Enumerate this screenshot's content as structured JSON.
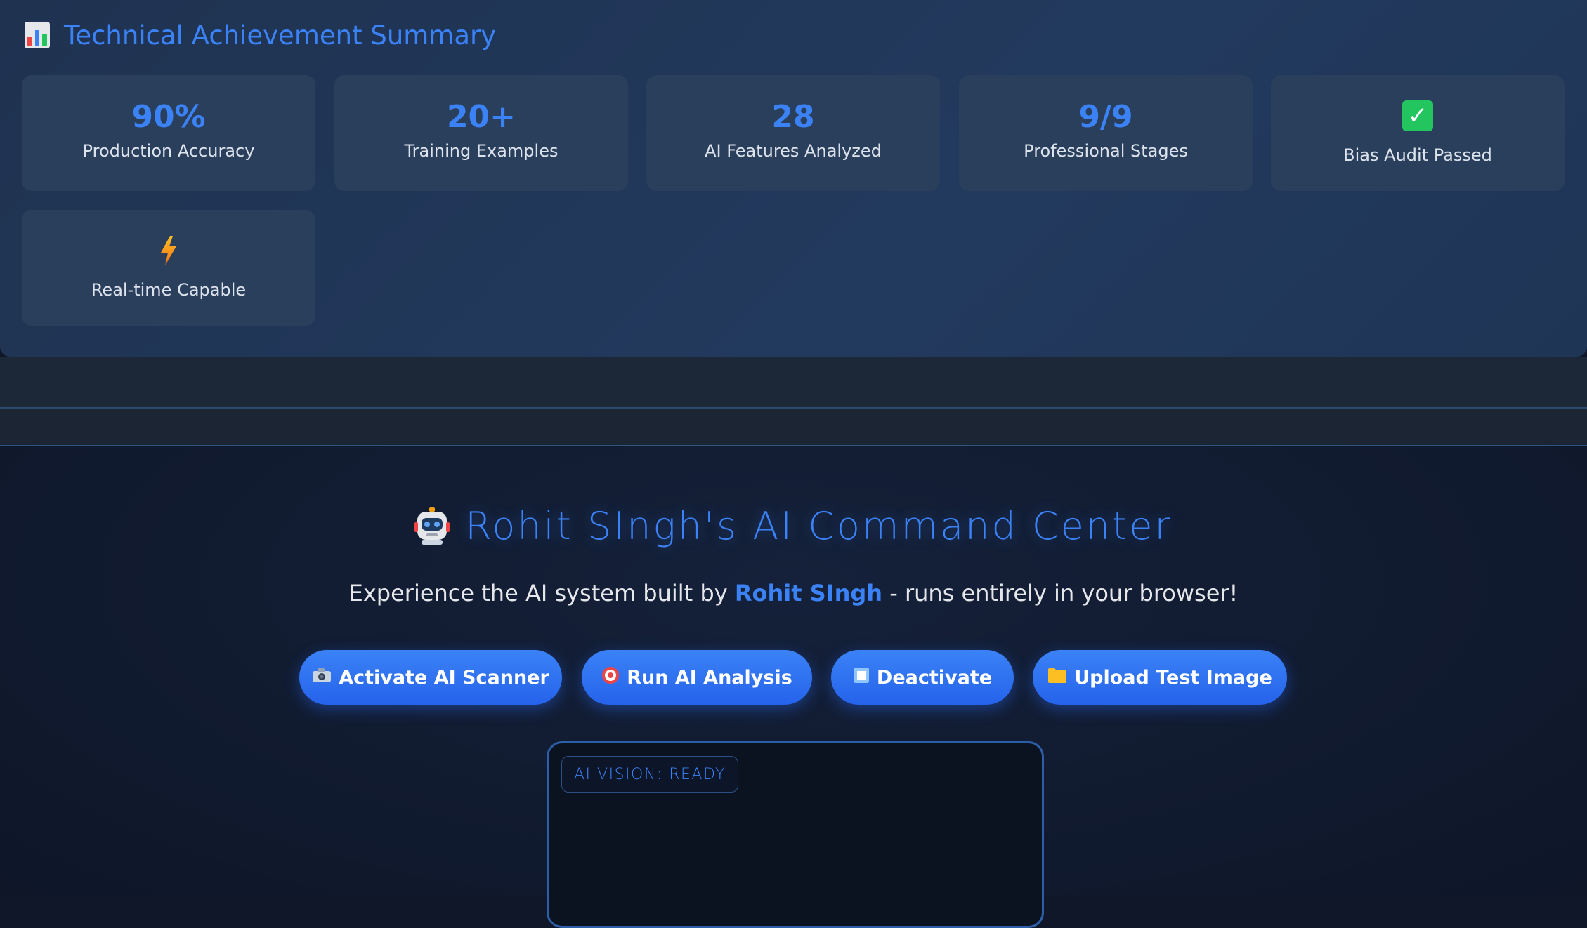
{
  "summary": {
    "title": "Technical Achievement Summary",
    "title_icon": "bar-chart-icon",
    "cards": [
      {
        "value": "90%",
        "label": "Production Accuracy"
      },
      {
        "value": "20+",
        "label": "Training Examples"
      },
      {
        "value": "28",
        "label": "AI Features Analyzed"
      },
      {
        "value": "9/9",
        "label": "Professional Stages"
      },
      {
        "icon": "check-mark-icon",
        "label": "Bias Audit Passed"
      },
      {
        "icon": "lightning-bolt-icon",
        "label": "Real-time Capable"
      }
    ]
  },
  "command_center": {
    "title": "Rohit SIngh's AI Command Center",
    "title_icon": "robot-icon",
    "subtitle_prefix": "Experience the AI system built by",
    "subtitle_name": "Rohit SIngh",
    "subtitle_suffix": "- runs entirely in your browser!",
    "buttons": [
      {
        "icon": "camera-icon",
        "label": "Activate AI Scanner"
      },
      {
        "icon": "target-icon",
        "label": "Run AI Analysis"
      },
      {
        "icon": "stop-icon",
        "label": "Deactivate"
      },
      {
        "icon": "folder-icon",
        "label": "Upload Test Image"
      }
    ],
    "vision_status": "AI VISION: READY"
  },
  "colors": {
    "accent": "#3b82f6",
    "panel": "#223a5e",
    "card": "#2a3f5c",
    "background": "#0f1729",
    "success": "#22c55e"
  }
}
